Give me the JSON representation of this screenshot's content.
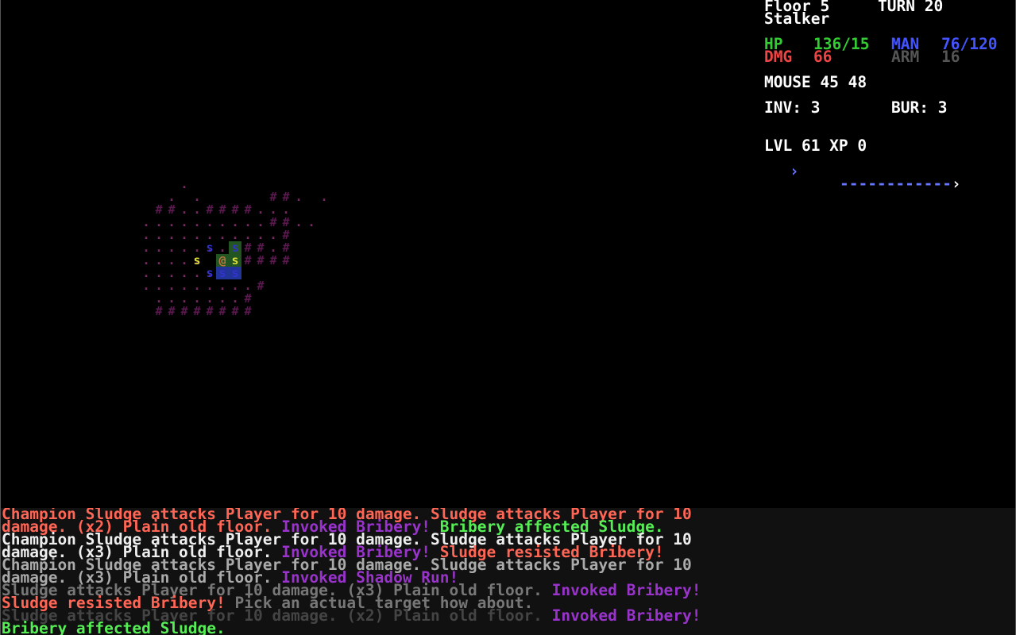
{
  "sidebar": {
    "floor": "Floor 5",
    "turn": "TURN 20",
    "class_name": "Stalker",
    "hp_label": "HP",
    "hp_value": "136/15",
    "mana_label": "MAN",
    "mana_value": "76/120",
    "dmg_label": "DMG",
    "dmg_value": "66",
    "arm_label": "ARM",
    "arm_value": "16",
    "mouse": "MOUSE 45 48",
    "inv": "INV: 3",
    "bur": "BUR: 3",
    "level": "LVL 61 XP 0",
    "xp_bar_arrow_left": "›",
    "xp_bar_dashes": "------------",
    "xp_bar_arrow_right": "›"
  },
  "colors": {
    "hp": "#33cc33",
    "mana": "#4455ff",
    "dmg": "#ee4444",
    "arm": "#555555",
    "wall": "#5a1a50",
    "floor": "#7a2a70",
    "sludge_blue": "#3333cc",
    "sludge_yellow": "#dddd33",
    "player": "#bb7744",
    "tile_green": "#225522",
    "tile_blue": "#223399"
  },
  "map": {
    "rows": [
      {
        "x": 14,
        "y": 14,
        "text": "."
      },
      {
        "x": 13,
        "y": 15,
        "text": ". ."
      },
      {
        "x": 21,
        "y": 15,
        "text": "##. ."
      },
      {
        "x": 12,
        "y": 16,
        "text": "##..####..."
      },
      {
        "x": 12,
        "y": 17,
        "text": ".........##.."
      },
      {
        "x": 11,
        "y": 17,
        "text": "."
      },
      {
        "x": 11,
        "y": 18,
        "text": "...........#"
      },
      {
        "x": 11,
        "y": 19,
        "text": "........##.#"
      },
      {
        "x": 11,
        "y": 20,
        "text": "....."
      },
      {
        "x": 11,
        "y": 21,
        "text": "......"
      },
      {
        "x": 10,
        "y": 20,
        "text": ""
      },
      {
        "x": 19,
        "y": 19,
        "text": ""
      },
      {
        "x": 20,
        "y": 20,
        "text": "###"
      },
      {
        "x": 19,
        "y": 20,
        "text": "#"
      },
      {
        "x": 11,
        "y": 22,
        "text": ".........#"
      },
      {
        "x": 12,
        "y": 23,
        "text": ".......#"
      },
      {
        "x": 12,
        "y": 24,
        "text": "########"
      }
    ],
    "entities": [
      {
        "x": 16,
        "y": 19,
        "ch": "s",
        "color": "sludge_blue",
        "bg": ""
      },
      {
        "x": 18,
        "y": 19,
        "ch": "s",
        "color": "sludge_blue",
        "bg": "tile_green"
      },
      {
        "x": 15,
        "y": 20,
        "ch": "s",
        "color": "sludge_yellow",
        "bg": ""
      },
      {
        "x": 17,
        "y": 20,
        "ch": "@",
        "color": "player",
        "bg": "tile_green"
      },
      {
        "x": 18,
        "y": 20,
        "ch": "s",
        "color": "sludge_yellow",
        "bg": "tile_green"
      },
      {
        "x": 16,
        "y": 21,
        "ch": "s",
        "color": "sludge_blue",
        "bg": ""
      },
      {
        "x": 17,
        "y": 21,
        "ch": "s",
        "color": "sludge_blue",
        "bg": "tile_blue"
      },
      {
        "x": 18,
        "y": 21,
        "ch": "s",
        "color": "sludge_blue",
        "bg": "tile_blue"
      }
    ]
  },
  "log": [
    [
      {
        "t": "Champion Sludge attacks Player for 10 damage. Sludge attacks Player for 10",
        "c": "#ff6655"
      }
    ],
    [
      {
        "t": "damage. (x2) Plain old floor. ",
        "c": "#ff6655"
      },
      {
        "t": "Invoked Bribery! ",
        "c": "#9933cc"
      },
      {
        "t": "Bribery affected Sludge.",
        "c": "#55ee55"
      }
    ],
    [
      {
        "t": "Champion Sludge attacks Player for 10 damage. Sludge attacks Player for 10",
        "c": "#eeeeee"
      }
    ],
    [
      {
        "t": "damage. (x3) Plain old floor. ",
        "c": "#eeeeee"
      },
      {
        "t": "Invoked Bribery! ",
        "c": "#9933cc"
      },
      {
        "t": "Sludge resisted Bribery!",
        "c": "#ff6655"
      }
    ],
    [
      {
        "t": "Champion Sludge attacks Player for 10 damage. Sludge attacks Player for 10",
        "c": "#aaaaaa"
      }
    ],
    [
      {
        "t": "damage. (x3) Plain old floor. ",
        "c": "#aaaaaa"
      },
      {
        "t": "Invoked Shadow Run!",
        "c": "#9933cc"
      }
    ],
    [
      {
        "t": "Sludge attacks Player for 10 damage. (x3) Plain old floor. ",
        "c": "#777777"
      },
      {
        "t": "Invoked Bribery!",
        "c": "#9933cc"
      }
    ],
    [
      {
        "t": "Sludge resisted Bribery! ",
        "c": "#ff6655"
      },
      {
        "t": "Pick an actual target how about.",
        "c": "#777777"
      }
    ],
    [
      {
        "t": "Sludge attacks Player for 10 damage. (x2) Plain old floor. ",
        "c": "#444444"
      },
      {
        "t": "Invoked Bribery!",
        "c": "#9933cc"
      }
    ],
    [
      {
        "t": "Bribery affected Sludge.",
        "c": "#55ee55"
      }
    ]
  ]
}
